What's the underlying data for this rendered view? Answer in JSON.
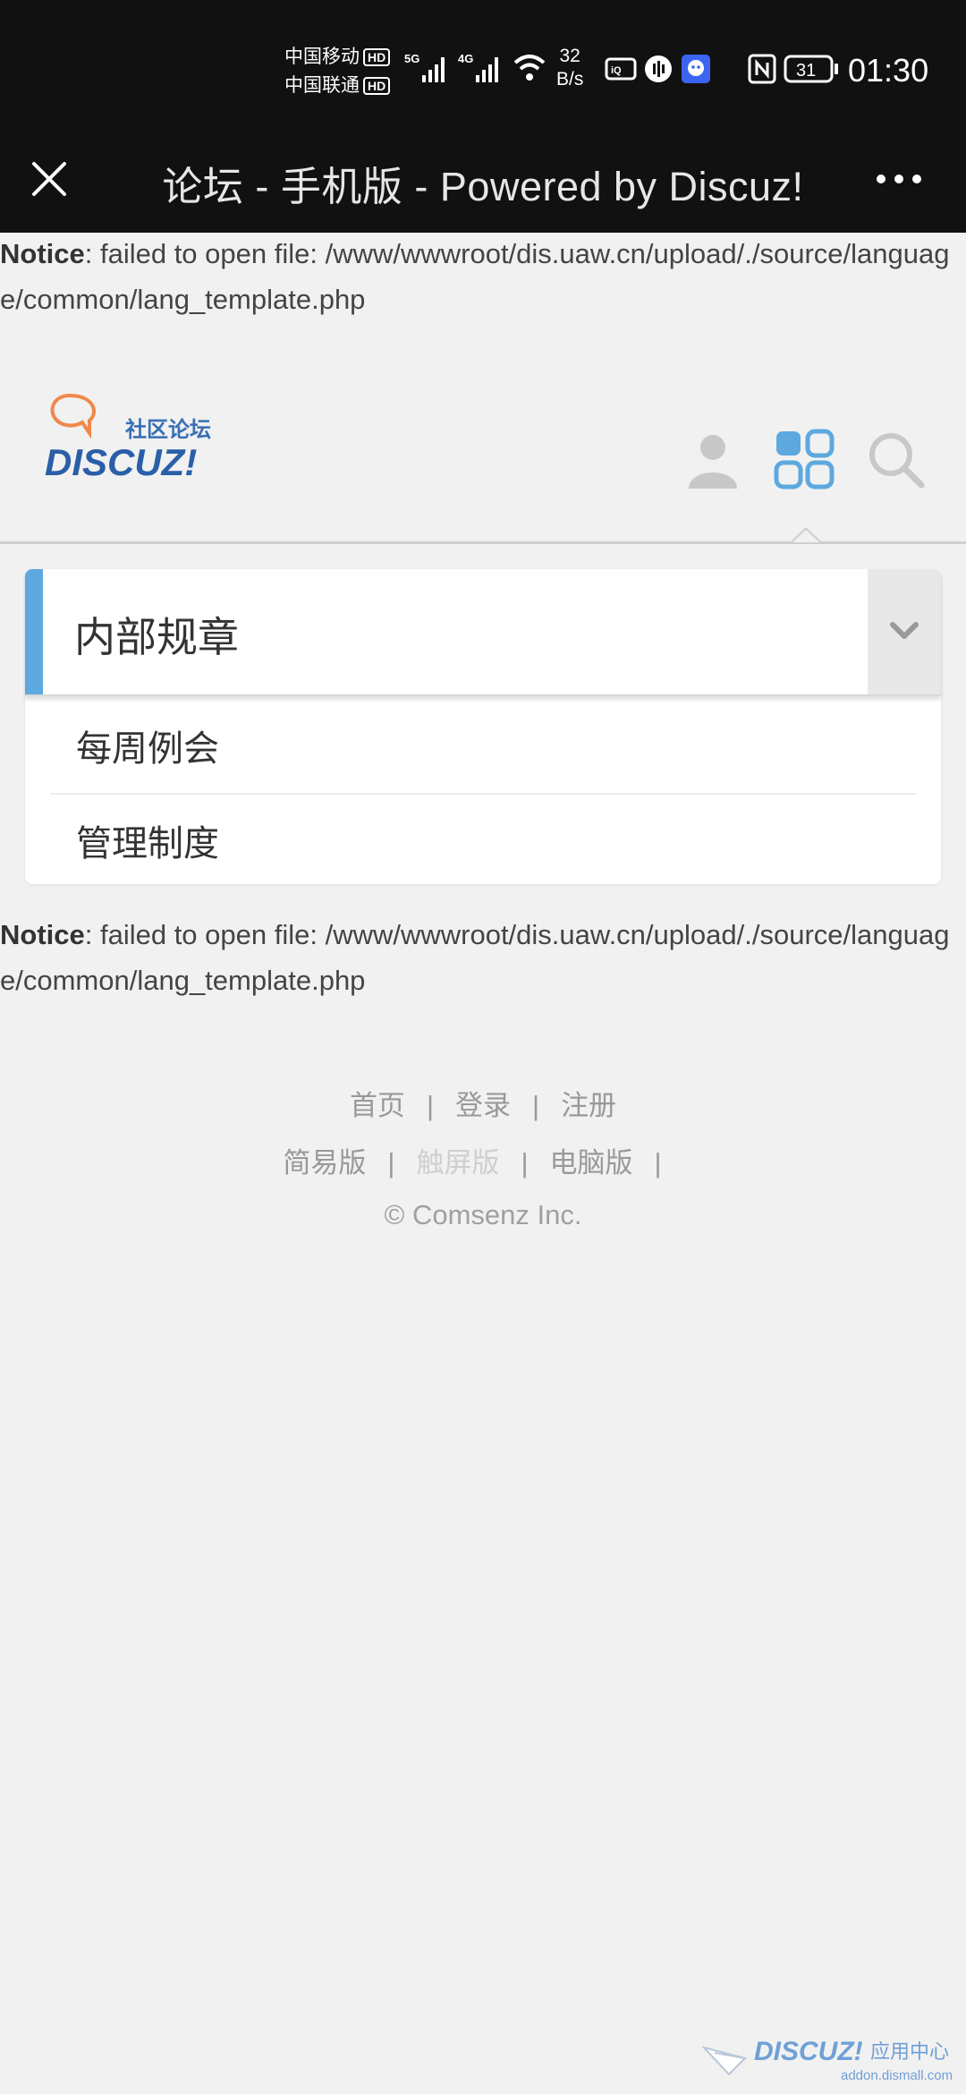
{
  "status_bar": {
    "carrier1": "中国移动",
    "carrier2": "中国联通",
    "hd_badge": "HD",
    "net_5g": "5G",
    "net_4g": "4G",
    "speed_value": "32",
    "speed_unit": "B/s",
    "battery": "31",
    "time": "01:30"
  },
  "titlebar": {
    "title": "论坛 - 手机版 - Powered by Discuz!"
  },
  "notices": [
    {
      "label": "Notice",
      "text": ": failed to open file: /www/wwwroot/dis.uaw.cn/upload/./source/language/common/lang_template.php"
    },
    {
      "label": "Notice",
      "text": ": failed to open file: /www/wwwroot/dis.uaw.cn/upload/./source/language/common/lang_template.php"
    }
  ],
  "logo": {
    "tagline": "社区论坛",
    "brand": "DISCUZ!"
  },
  "forum": {
    "category": "内部规章",
    "items": [
      "每周例会",
      "管理制度"
    ]
  },
  "footer": {
    "links_row1": [
      "首页",
      "登录",
      "注册"
    ],
    "links_row2": [
      "简易版",
      "触屏版",
      "电脑版"
    ],
    "separator": "|",
    "copyright": "© Comsenz Inc."
  },
  "watermark": {
    "brand": "DISCUZ!",
    "title": "应用中心",
    "url": "addon.dismall.com"
  },
  "colors": {
    "accent": "#5da8df",
    "bar": "#111111",
    "background": "#f1f1f1"
  }
}
